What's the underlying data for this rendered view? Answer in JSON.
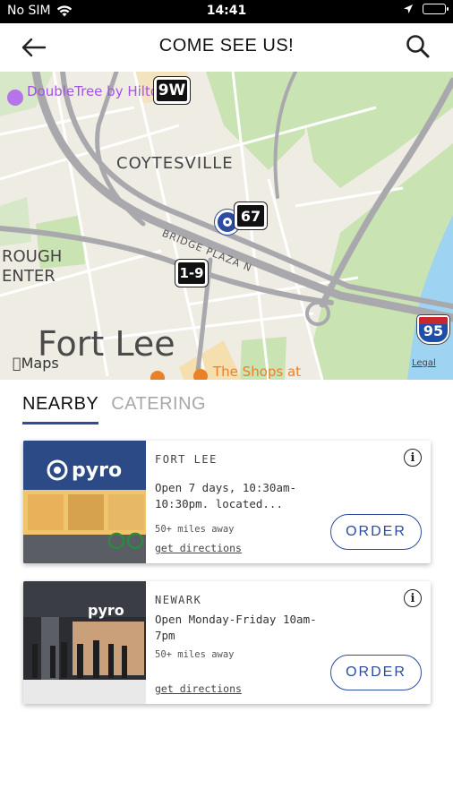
{
  "status_bar": {
    "carrier": "No SIM",
    "time": "14:41"
  },
  "header": {
    "title": "COME SEE US!"
  },
  "map": {
    "labels": {
      "doubletree": "DoubleTree by Hilton",
      "coytesville": "COYTESVILLE",
      "bridge_plaza": "BRIDGE PLAZA N",
      "rough_center": "ROUGH\nENTER",
      "fort_lee": "Fort Lee",
      "shops": "The Shops at",
      "maps_brand": "Maps",
      "legal": "Legal"
    },
    "shields": {
      "route_9w": "9W",
      "route_67": "67",
      "route_1_9": "1-9",
      "interstate_95": "95"
    }
  },
  "tabs": [
    {
      "label": "NEARBY",
      "active": true
    },
    {
      "label": "CATERING",
      "active": false
    }
  ],
  "locations": [
    {
      "city": "FORT LEE",
      "description": "Open 7 days, 10:30am-10:30pm. located...",
      "distance": "50+ miles away",
      "directions": "get directions",
      "order_label": "ORDER",
      "photo_sign": "pyro"
    },
    {
      "city": "NEWARK",
      "description": "Open Monday-Friday 10am-7pm",
      "distance": "50+ miles away",
      "directions": "get directions",
      "order_label": "ORDER",
      "photo_sign": "pyro"
    }
  ],
  "colors": {
    "accent": "#2d4ba0",
    "map_bg": "#efece4",
    "park": "#c9e3b3",
    "water": "#9fd3f2"
  }
}
